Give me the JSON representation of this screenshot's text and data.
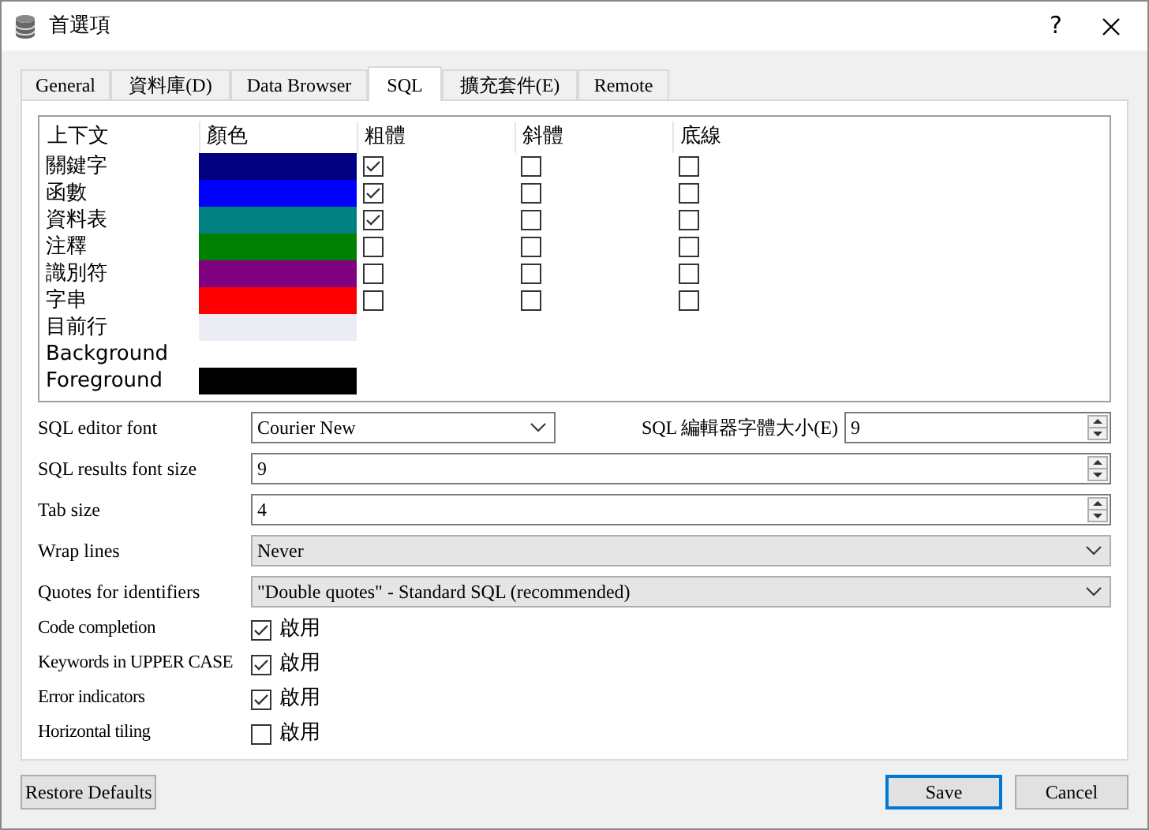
{
  "window": {
    "title": "首選項",
    "help": "?"
  },
  "tabs": [
    {
      "label": "General",
      "selected": false
    },
    {
      "label": "資料庫(D)",
      "selected": false
    },
    {
      "label": "Data Browser",
      "selected": false
    },
    {
      "label": "SQL",
      "selected": true
    },
    {
      "label": "擴充套件(E)",
      "selected": false
    },
    {
      "label": "Remote",
      "selected": false
    }
  ],
  "color_table": {
    "columns": [
      "上下文",
      "顏色",
      "粗體",
      "斜體",
      "底線"
    ],
    "rows": [
      {
        "context": "關鍵字",
        "color": "#000080",
        "bold": true,
        "italic": false,
        "underline": false
      },
      {
        "context": "函數",
        "color": "#0000ff",
        "bold": true,
        "italic": false,
        "underline": false
      },
      {
        "context": "資料表",
        "color": "#008080",
        "bold": true,
        "italic": false,
        "underline": false
      },
      {
        "context": "注釋",
        "color": "#008000",
        "bold": false,
        "italic": false,
        "underline": false
      },
      {
        "context": "識別符",
        "color": "#800080",
        "bold": false,
        "italic": false,
        "underline": false
      },
      {
        "context": "字串",
        "color": "#ff0000",
        "bold": false,
        "italic": false,
        "underline": false
      },
      {
        "context": "目前行",
        "color": "#ececf4"
      },
      {
        "context": "Background"
      },
      {
        "context": "Foreground",
        "color": "#000000"
      }
    ]
  },
  "editor_font": {
    "label": "SQL editor font",
    "value": "Courier New"
  },
  "editor_font_size": {
    "label": "SQL 編輯器字體大小(E)",
    "value": "9"
  },
  "settings": [
    {
      "kind": "spin",
      "label": "SQL results font size",
      "value": "9"
    },
    {
      "kind": "spin",
      "label": "Tab size",
      "value": "4"
    },
    {
      "kind": "select",
      "label": "Wrap lines",
      "value": "Never"
    },
    {
      "kind": "select",
      "label": "Quotes for identifiers",
      "value": "\"Double quotes\" - Standard SQL (recommended)"
    },
    {
      "kind": "check",
      "label": "Code completion",
      "text": "啟用",
      "checked": true
    },
    {
      "kind": "check",
      "label": "Keywords in UPPER CASE",
      "text": "啟用",
      "checked": true
    },
    {
      "kind": "check",
      "label": "Error indicators",
      "text": "啟用",
      "checked": true
    },
    {
      "kind": "check",
      "label": "Horizontal tiling",
      "text": "啟用",
      "checked": false
    }
  ],
  "buttons": {
    "restore": "Restore Defaults",
    "save": "Save",
    "cancel": "Cancel"
  }
}
